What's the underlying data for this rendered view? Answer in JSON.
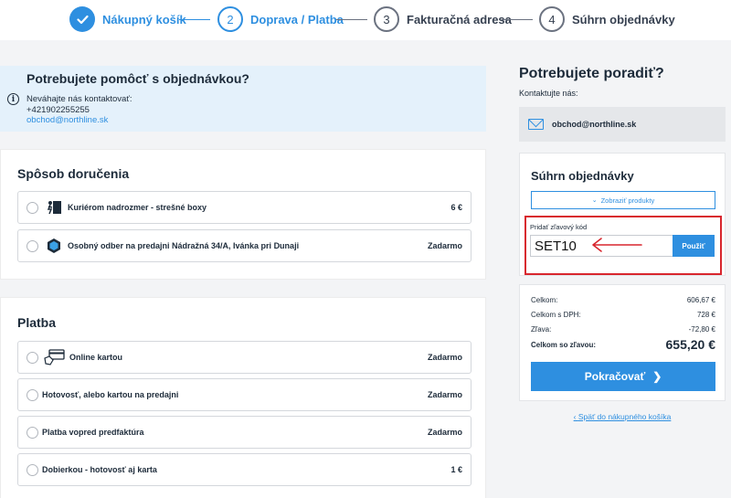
{
  "stepper": {
    "steps": [
      {
        "number": "",
        "label": "Nákupný košík",
        "state": "done"
      },
      {
        "number": "2",
        "label": "Doprava / Platba",
        "state": "active"
      },
      {
        "number": "3",
        "label": "Fakturačná adresa",
        "state": "todo"
      },
      {
        "number": "4",
        "label": "Súhrn objednávky",
        "state": "todo"
      }
    ]
  },
  "help": {
    "title": "Potrebujete pomôcť s objednávkou?",
    "line1": "Neváhajte nás kontaktovať:",
    "phone": "+421902255255",
    "email": "obchod@northline.sk"
  },
  "delivery": {
    "title": "Spôsob doručenia",
    "options": [
      {
        "label": "Kuriérom nadrozmer - strešné boxy",
        "price": "6 €",
        "icon": "courier-icon"
      },
      {
        "label": "Osobný odber na predajni Nádražná 34/A, Ivánka pri Dunaji",
        "price": "Zadarmo",
        "icon": "store-pickup-icon"
      }
    ]
  },
  "payment": {
    "title": "Platba",
    "options": [
      {
        "label": "Online kartou",
        "price": "Zadarmo",
        "icon": "card-icon"
      },
      {
        "label": "Hotovosť, alebo kartou na predajni",
        "price": "Zadarmo"
      },
      {
        "label": "Platba vopred predfaktúra",
        "price": "Zadarmo"
      },
      {
        "label": "Dobierkou - hotovosť aj karta",
        "price": "1 €"
      }
    ]
  },
  "advice": {
    "title": "Potrebujete poradiť?",
    "contact_label": "Kontaktujte nás:",
    "email": "obchod@northline.sk"
  },
  "summary": {
    "title": "Súhrn objednávky",
    "show_products": "Zobraziť produkty",
    "coupon_label": "Pridať zľavový kód",
    "coupon_value": "SET10",
    "apply_label": "Použiť",
    "rows": [
      {
        "label": "Celkom:",
        "value": "606,67 €"
      },
      {
        "label": "Celkom s DPH:",
        "value": "728 €"
      },
      {
        "label": "Zľava:",
        "value": "-72,80 €"
      }
    ],
    "final_label": "Celkom so zľavou:",
    "final_value": "655,20 €",
    "continue_label": "Pokračovať",
    "back_link": "Späť do nákupného košíka"
  },
  "colors": {
    "accent": "#2e8fe0",
    "highlight": "#d8262e"
  }
}
